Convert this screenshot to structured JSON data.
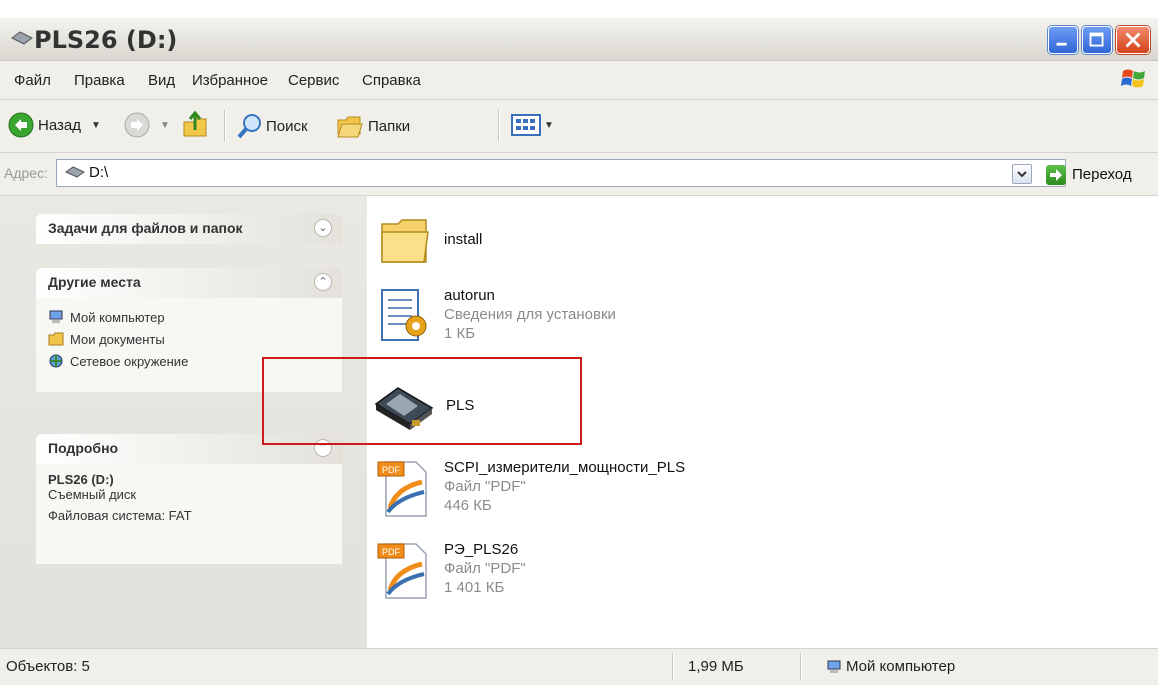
{
  "window": {
    "title": "PLS26 (D:)"
  },
  "menu": {
    "items": [
      "Файл",
      "Правка",
      "Вид",
      "Избранное",
      "Сервис",
      "Справка"
    ]
  },
  "toolbar": {
    "back": "Назад",
    "search": "Поиск",
    "folders": "Папки"
  },
  "address": {
    "label": "Адрес:",
    "value": "D:\\",
    "go": "Переход"
  },
  "left_panel": {
    "tasks": {
      "title": "Задачи для файлов и папок"
    },
    "places": {
      "title": "Другие места",
      "links": [
        "Мой компьютер",
        "Мои документы",
        "Сетевое окружение"
      ]
    },
    "details": {
      "title": "Подробно",
      "name": "PLS26 (D:)",
      "type": "Съемный диск",
      "fs": "Файловая система: FAT"
    }
  },
  "files": [
    {
      "name": "install",
      "type": "",
      "size": "",
      "icon": "folder-icon"
    },
    {
      "name": "autorun",
      "type": "Сведения для установки",
      "size": "1 КБ",
      "icon": "setup-info-icon"
    },
    {
      "name": "PLS",
      "type": "",
      "size": "",
      "icon": "device-icon"
    },
    {
      "name": "SCPI_измерители_мощности_PLS",
      "type": "Файл \"PDF\"",
      "size": "446 КБ",
      "icon": "pdf-icon"
    },
    {
      "name": "РЭ_PLS26",
      "type": "Файл \"PDF\"",
      "size": "1 401 КБ",
      "icon": "pdf-icon"
    }
  ],
  "status": {
    "objects": "Объектов: 5",
    "size": "1,99 МБ",
    "location": "Мой компьютер"
  }
}
